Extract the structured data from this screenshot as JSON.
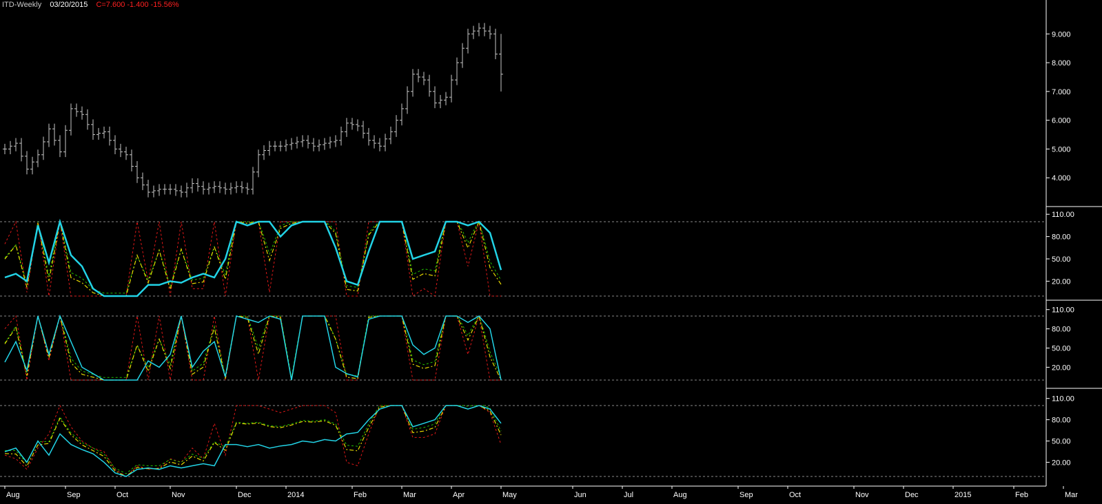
{
  "header": {
    "symbol": "ITD-Weekly",
    "date": "03/20/2015",
    "change_text": "C=7.600  -1.400  -15.56%"
  },
  "colors": {
    "background": "#000000",
    "price_bars": "#c8c8c8",
    "cyan": "#22d3e6",
    "yellow": "#e6d800",
    "green": "#22c000",
    "red": "#e01818",
    "ref_lines": "#8a8a8a",
    "axis_text": "#ffffff"
  },
  "x_axis": {
    "labels": [
      "Aug",
      "Sep",
      "Oct",
      "Nov",
      "Dec",
      "2014",
      "Feb",
      "Mar",
      "Apr",
      "May",
      "Jun",
      "Jul",
      "Aug",
      "Sep",
      "Oct",
      "Nov",
      "Dec",
      "2015",
      "Feb",
      "Mar"
    ],
    "label_week_index": [
      0,
      11,
      20,
      30,
      42,
      51,
      63,
      72,
      81,
      90,
      103,
      112,
      121,
      133,
      142,
      154,
      163,
      172,
      183,
      192
    ]
  },
  "chart_data": [
    {
      "type": "ohlc",
      "name": "ITD-Weekly",
      "interval": "weekly",
      "y_ticks": [
        "4.000",
        "5.000",
        "6.000",
        "7.000",
        "8.000",
        "9.000"
      ],
      "close_sampled_every_2_weeks": [
        5.0,
        5.2,
        4.3,
        4.8,
        5.7,
        4.9,
        6.4,
        6.2,
        5.5,
        5.6,
        5.0,
        4.8,
        4.0,
        3.5,
        3.6,
        3.6,
        3.5,
        3.8,
        3.6,
        3.7,
        3.6,
        3.7,
        3.6,
        4.8,
        5.1,
        5.1,
        5.2,
        5.3,
        5.1,
        5.2,
        5.3,
        5.9,
        5.8,
        5.3,
        5.1,
        5.6,
        6.4,
        7.6,
        7.4,
        6.6,
        6.8,
        8.0,
        9.0,
        9.2,
        9.0,
        7.6
      ],
      "last_bar": {
        "close": 7.6,
        "change": -1.4,
        "change_pct": -15.56
      }
    },
    {
      "type": "line",
      "panel": "indicator-1",
      "y_ticks": [
        "20.00",
        "50.00",
        "80.00",
        "110.00"
      ],
      "reference_lines": [
        0,
        100
      ],
      "series": [
        {
          "color": "cyan",
          "values_sampled_every_2_weeks": [
            25,
            30,
            20,
            95,
            45,
            100,
            55,
            40,
            10,
            0,
            0,
            0,
            0,
            15,
            15,
            20,
            18,
            25,
            30,
            25,
            50,
            100,
            95,
            100,
            100,
            80,
            95,
            100,
            100,
            100,
            65,
            20,
            15,
            60,
            100,
            100,
            100,
            50,
            55,
            60,
            100,
            100,
            95,
            100,
            85,
            35
          ]
        },
        {
          "color": "red",
          "values_sampled_every_2_weeks": [
            70,
            100,
            5,
            100,
            0,
            100,
            0,
            0,
            0,
            0,
            0,
            0,
            100,
            20,
            100,
            0,
            100,
            10,
            10,
            100,
            0,
            100,
            100,
            100,
            5,
            100,
            100,
            100,
            100,
            100,
            100,
            0,
            0,
            100,
            100,
            100,
            100,
            0,
            10,
            0,
            100,
            100,
            40,
            100,
            0,
            0
          ]
        }
      ]
    },
    {
      "type": "line",
      "panel": "indicator-2",
      "y_ticks": [
        "20.00",
        "50.00",
        "80.00",
        "110.00"
      ],
      "reference_lines": [
        0,
        100
      ],
      "series": [
        {
          "color": "cyan",
          "values_sampled_every_2_weeks": [
            28,
            60,
            15,
            100,
            40,
            100,
            60,
            20,
            10,
            0,
            0,
            0,
            0,
            30,
            20,
            40,
            100,
            20,
            45,
            60,
            5,
            100,
            95,
            90,
            100,
            95,
            0,
            100,
            100,
            100,
            20,
            10,
            5,
            95,
            100,
            100,
            100,
            55,
            40,
            50,
            100,
            100,
            90,
            100,
            80,
            0
          ]
        },
        {
          "color": "red",
          "values_sampled_every_2_weeks": [
            80,
            100,
            0,
            100,
            30,
            100,
            0,
            0,
            0,
            0,
            0,
            0,
            100,
            0,
            100,
            0,
            100,
            0,
            0,
            100,
            0,
            100,
            100,
            0,
            100,
            100,
            0,
            100,
            100,
            100,
            100,
            0,
            0,
            100,
            100,
            100,
            100,
            0,
            0,
            0,
            100,
            100,
            40,
            100,
            0,
            0
          ]
        }
      ]
    },
    {
      "type": "line",
      "panel": "indicator-3",
      "y_ticks": [
        "20.00",
        "50.00",
        "80.00",
        "110.00"
      ],
      "reference_lines": [
        0,
        100
      ],
      "series": [
        {
          "color": "cyan",
          "values_sampled_every_2_weeks": [
            35,
            40,
            20,
            50,
            30,
            60,
            45,
            38,
            32,
            20,
            5,
            0,
            10,
            12,
            10,
            15,
            12,
            15,
            18,
            15,
            45,
            45,
            42,
            45,
            40,
            43,
            45,
            50,
            48,
            52,
            50,
            60,
            62,
            80,
            95,
            100,
            100,
            70,
            75,
            80,
            100,
            100,
            95,
            100,
            95,
            75
          ]
        },
        {
          "color": "red",
          "values_sampled_every_2_weeks": [
            30,
            25,
            10,
            40,
            60,
            100,
            70,
            50,
            40,
            35,
            10,
            0,
            15,
            10,
            12,
            25,
            20,
            40,
            25,
            75,
            30,
            100,
            100,
            100,
            95,
            90,
            95,
            100,
            100,
            100,
            90,
            20,
            15,
            60,
            100,
            100,
            100,
            55,
            55,
            60,
            100,
            100,
            95,
            100,
            90,
            45
          ]
        }
      ]
    }
  ]
}
